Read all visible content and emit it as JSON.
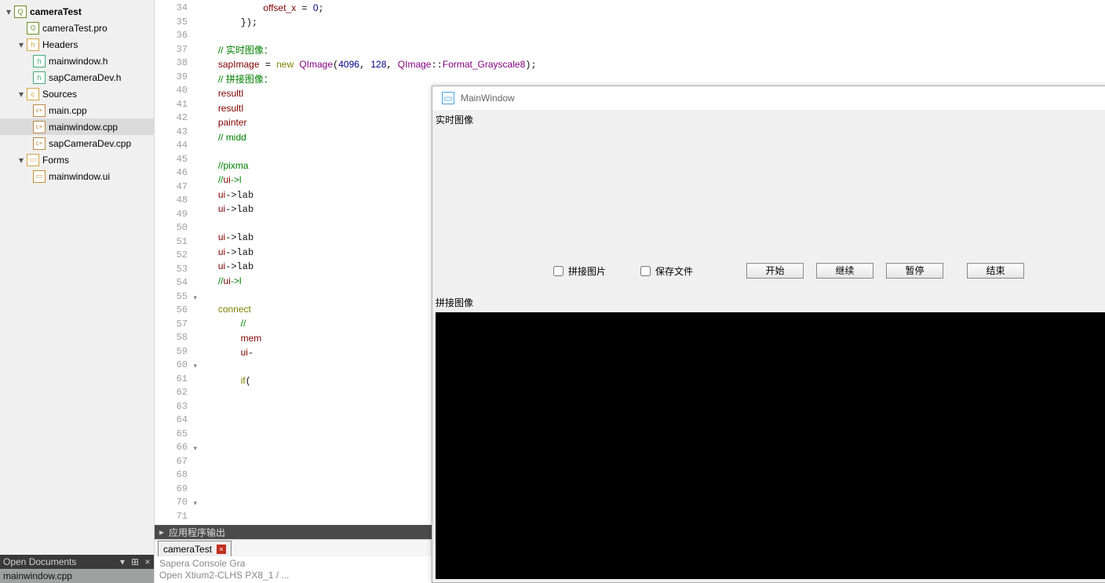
{
  "project": {
    "root": "cameraTest",
    "pro_file": "cameraTest.pro",
    "headers_label": "Headers",
    "headers": [
      "mainwindow.h",
      "sapCameraDev.h"
    ],
    "sources_label": "Sources",
    "sources": [
      "main.cpp",
      "mainwindow.cpp",
      "sapCameraDev.cpp"
    ],
    "forms_label": "Forms",
    "forms": [
      "mainwindow.ui"
    ],
    "selected_file": "mainwindow.cpp"
  },
  "open_docs": {
    "header": "Open Documents",
    "items": [
      "mainwindow.cpp"
    ]
  },
  "editor": {
    "first_line_no": 34,
    "lines": [
      "            offset_x = 0;",
      "        });",
      "",
      "    // 实时图像：",
      "    sapImage = new QImage(4096, 128, QImage::Format_Grayscale8);",
      "    // 拼接图像：",
      "    resultI",
      "    resultI",
      "    painter",
      "    // midd",
      "",
      "    //pixma",
      "    //ui->l",
      "    ui->lab",
      "    ui->lab",
      "",
      "    ui->lab",
      "    ui->lab",
      "    ui->lab",
      "    //ui->l",
      "",
      "    connect",
      "        //",
      "        mem",
      "        ui-",
      "",
      "        if(",
      "",
      "",
      "",
      "",
      "",
      "",
      "",
      "",
      "",
      "",
      ""
    ],
    "fold_lines": [
      55,
      60,
      66,
      70
    ]
  },
  "output": {
    "panel_title": "应用程序输出",
    "tab": "cameraTest",
    "lines": [
      "Sapera Console Gra",
      "Open Xtium2-CLHS PX8_1 / ..."
    ]
  },
  "appwin": {
    "title": "MainWindow",
    "live_label": "实时图像",
    "stitch_label": "拼接图像",
    "chk_stitch": "拼接图片",
    "chk_save": "保存文件",
    "btn_start": "开始",
    "btn_cont": "继续",
    "btn_pause": "暂停",
    "btn_stop": "结束"
  }
}
